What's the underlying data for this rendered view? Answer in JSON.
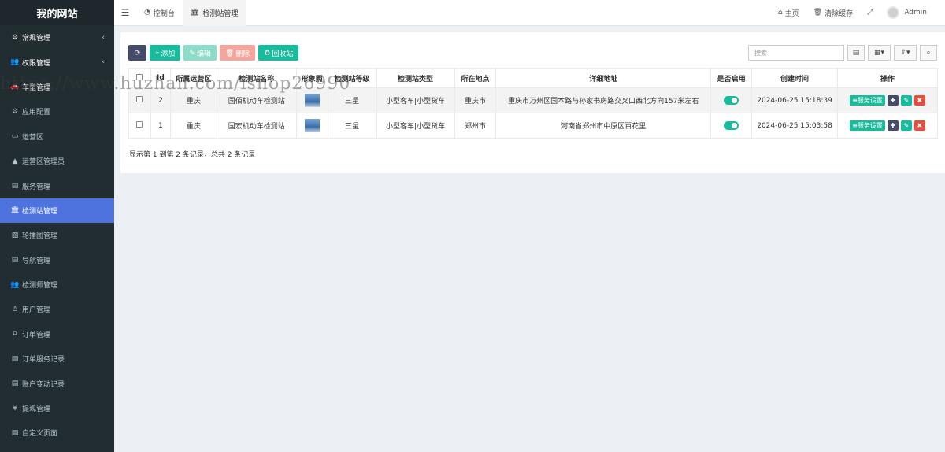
{
  "brand": "我的网站",
  "sidebar": {
    "items": [
      {
        "label": "常规管理",
        "icon": "cogs-icon",
        "glyph": "⚙",
        "chev": "‹"
      },
      {
        "label": "权限管理",
        "icon": "group-icon",
        "glyph": "👥",
        "chev": "‹"
      },
      {
        "label": "车型管理",
        "icon": "car-icon",
        "glyph": "🚗",
        "chev": ""
      },
      {
        "label": "应用配置",
        "icon": "gear-icon",
        "glyph": "⚙",
        "chev": ""
      },
      {
        "label": "运营区",
        "icon": "map-icon",
        "glyph": "▭",
        "chev": ""
      },
      {
        "label": "运营区管理员",
        "icon": "user-icon",
        "glyph": "▲",
        "chev": ""
      },
      {
        "label": "服务管理",
        "icon": "list-icon",
        "glyph": "▤",
        "chev": ""
      },
      {
        "label": "检测站管理",
        "icon": "bank-icon",
        "glyph": "🏛",
        "chev": ""
      },
      {
        "label": "轮播图管理",
        "icon": "image-icon",
        "glyph": "▨",
        "chev": ""
      },
      {
        "label": "导航管理",
        "icon": "list-icon",
        "glyph": "▤",
        "chev": ""
      },
      {
        "label": "检测师管理",
        "icon": "users-icon",
        "glyph": "👥",
        "chev": ""
      },
      {
        "label": "用户管理",
        "icon": "user-o-icon",
        "glyph": "♙",
        "chev": ""
      },
      {
        "label": "订单管理",
        "icon": "clone-icon",
        "glyph": "⧉",
        "chev": ""
      },
      {
        "label": "订单服务记录",
        "icon": "file-icon",
        "glyph": "▤",
        "chev": ""
      },
      {
        "label": "账户变动记录",
        "icon": "file-icon",
        "glyph": "▤",
        "chev": ""
      },
      {
        "label": "提现管理",
        "icon": "yen-icon",
        "glyph": "¥",
        "chev": ""
      },
      {
        "label": "自定义页面",
        "icon": "file-text-icon",
        "glyph": "▤",
        "chev": ""
      }
    ]
  },
  "header": {
    "tabs": [
      {
        "label": "控制台",
        "glyph": "◔"
      },
      {
        "label": "检测站管理",
        "glyph": "🏛"
      }
    ],
    "home": "主页",
    "clear_cache": "清除缓存",
    "fullscreen_glyph": "⤢",
    "user": "Admin"
  },
  "toolbar": {
    "add": "添加",
    "edit": "编辑",
    "delete": "删除",
    "recycle": "回收站",
    "search_placeholder": "搜索"
  },
  "table": {
    "columns": [
      "Id",
      "所属运营区",
      "检测站名称",
      "形象照",
      "检测站等级",
      "检测站类型",
      "所在地点",
      "详细地址",
      "是否启用",
      "创建时间",
      "操作"
    ],
    "rows": [
      {
        "id": "2",
        "area": "重庆",
        "name": "国佰机动车检测站",
        "level": "三星",
        "type": "小型客车|小型货车",
        "location": "重庆市",
        "address": "重庆市万州区国本路与孙家书房路交叉口西北方向157米左右",
        "enabled": true,
        "created": "2024-06-25 15:18:39",
        "svc": "服务设置"
      },
      {
        "id": "1",
        "area": "重庆",
        "name": "国宏机动车检测站",
        "level": "三星",
        "type": "小型客车|小型货车",
        "location": "郑州市",
        "address": "河南省郑州市中原区百花里",
        "enabled": true,
        "created": "2024-06-25 15:03:58",
        "svc": "服务设置"
      }
    ]
  },
  "pager": "显示第 1 到第 2 条记录，总共 2 条记录",
  "watermark": "https://www.huzhan.com/ishop26990",
  "colors": {
    "sidebar": "#222d32",
    "active": "#4e73df",
    "green": "#18bc9c",
    "red": "#e74c3c",
    "dark": "#444c69"
  }
}
